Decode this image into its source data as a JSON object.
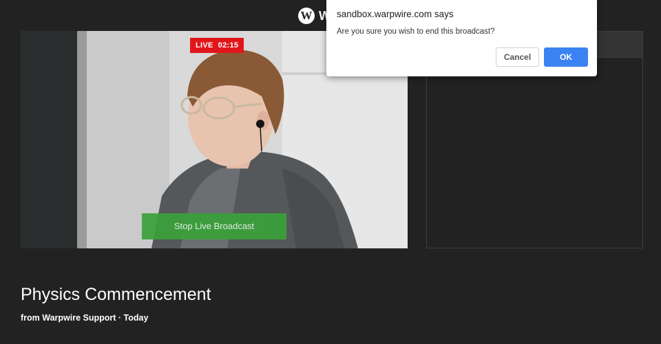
{
  "header": {
    "logo_letter": "W",
    "app_name": "W"
  },
  "video": {
    "live_label": "LIVE",
    "live_timer": "02:15",
    "stop_button_label": "Stop Live Broadcast"
  },
  "broadcast": {
    "title": "Physics Commencement",
    "subtitle": "from Warpwire Support · Today"
  },
  "dialog": {
    "origin": "sandbox.warpwire.com says",
    "message": "Are you sure you wish to end this broadcast?",
    "cancel_label": "Cancel",
    "ok_label": "OK"
  },
  "colors": {
    "background": "#222222",
    "live_red": "#e0161b",
    "stop_green": "#3aa13a",
    "ok_blue": "#3b82f2"
  }
}
